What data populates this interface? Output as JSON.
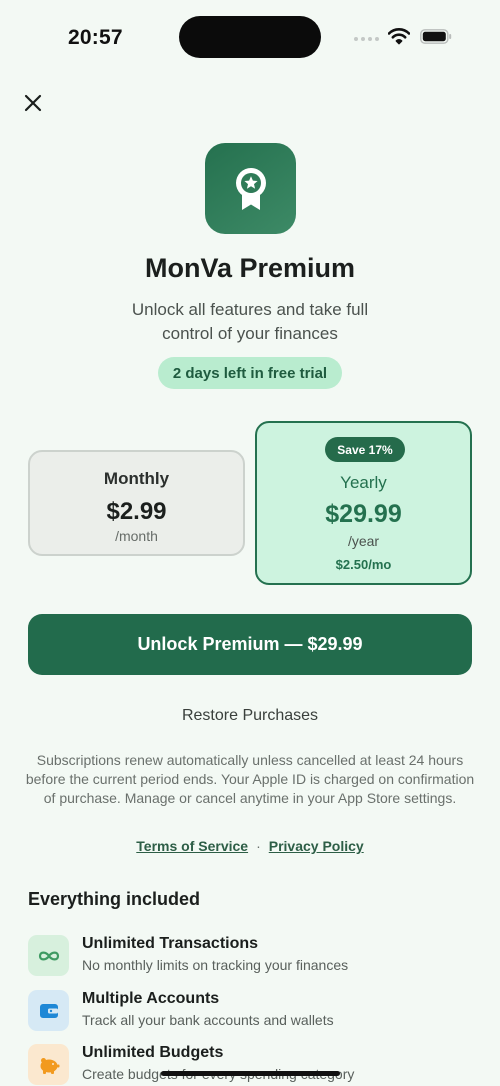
{
  "status_bar": {
    "time": "20:57"
  },
  "header": {
    "close_icon": "close-icon"
  },
  "hero": {
    "icon": "award-ribbon-icon",
    "title": "MonVa Premium",
    "subtitle": "Unlock all features and take full control of your finances",
    "trial_badge": "2 days left in free trial"
  },
  "plans": {
    "monthly": {
      "name": "Monthly",
      "price": "$2.99",
      "period": "/month"
    },
    "yearly": {
      "badge": "Save 17%",
      "name": "Yearly",
      "price": "$29.99",
      "period": "/year",
      "per_month": "$2.50/mo",
      "selected": true
    }
  },
  "cta": {
    "label": "Unlock Premium — $29.99"
  },
  "restore": {
    "label": "Restore Purchases"
  },
  "legal": {
    "text": "Subscriptions renew automatically unless cancelled at least 24 hours before the current period ends. Your Apple ID is charged on confirmation of purchase. Manage or cancel anytime in your App Store settings.",
    "terms_label": "Terms of Service",
    "separator": "·",
    "privacy_label": "Privacy Policy"
  },
  "features": {
    "title": "Everything included",
    "items": [
      {
        "icon": "infinity-icon",
        "title": "Unlimited Transactions",
        "desc": "No monthly limits on tracking your finances"
      },
      {
        "icon": "wallet-icon",
        "title": "Multiple Accounts",
        "desc": "Track all your bank accounts and wallets"
      },
      {
        "icon": "piggy-bank-icon",
        "title": "Unlimited Budgets",
        "desc": "Create budgets for every spending category"
      }
    ]
  },
  "colors": {
    "background": "#f3f9f4",
    "accent": "#226b4c",
    "accent_light": "#cdf3df",
    "trial_pill": "#b9eccf"
  }
}
